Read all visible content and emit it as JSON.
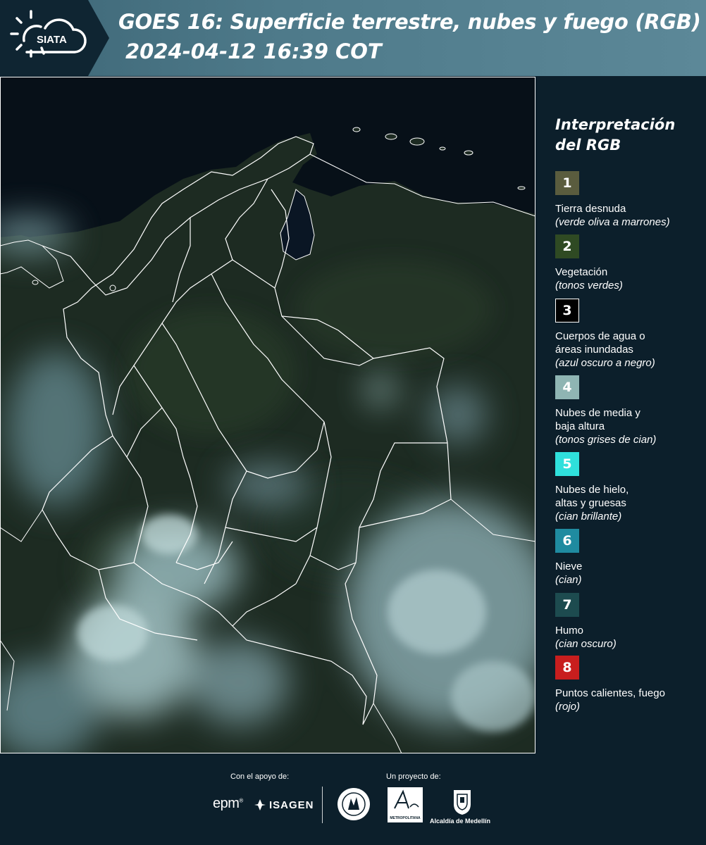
{
  "header": {
    "logo_text": "SIATA",
    "title": "GOES 16: Superficie terrestre, nubes y fuego (RGB)",
    "timestamp": "2024-04-12 16:39 COT"
  },
  "map": {
    "colors": {
      "ocean": "#071018",
      "land": "#1e2c24",
      "cloud": "#a9c9cc",
      "border": "#ffffff"
    }
  },
  "legend": {
    "title": "Interpretación del RGB",
    "items": [
      {
        "number": "1",
        "color": "#5a5c3e",
        "label": "Tierra desnuda",
        "desc": "(verde oliva a marrones)"
      },
      {
        "number": "2",
        "color": "#2f4a23",
        "label": "Vegetación",
        "desc": "(tonos verdes)"
      },
      {
        "number": "3",
        "color": "#000000",
        "label": "Cuerpos de agua o\náreas inundadas",
        "desc": "(azul oscuro a negro)"
      },
      {
        "number": "4",
        "color": "#8fb5b3",
        "label": "Nubes de media y\nbaja altura",
        "desc": "(tonos grises de cian)"
      },
      {
        "number": "5",
        "color": "#2fe0dc",
        "label": "Nubes de hielo,\naltas y gruesas",
        "desc": "(cian brillante)"
      },
      {
        "number": "6",
        "color": "#1f8ba0",
        "label": "Nieve",
        "desc": "(cian)"
      },
      {
        "number": "7",
        "color": "#1d4b4f",
        "label": "Humo",
        "desc": "(cian oscuro)"
      },
      {
        "number": "8",
        "color": "#c81e1e",
        "label": "Puntos calientes, fuego",
        "desc": "(rojo)"
      }
    ]
  },
  "footer": {
    "support_label": "Con el apoyo de:",
    "project_label": "Un proyecto de:",
    "epm": "epm",
    "isagen": "ISAGEN",
    "area_metro": "METROPOLITANA",
    "alcaldia": "Alcaldía de Medellín"
  }
}
